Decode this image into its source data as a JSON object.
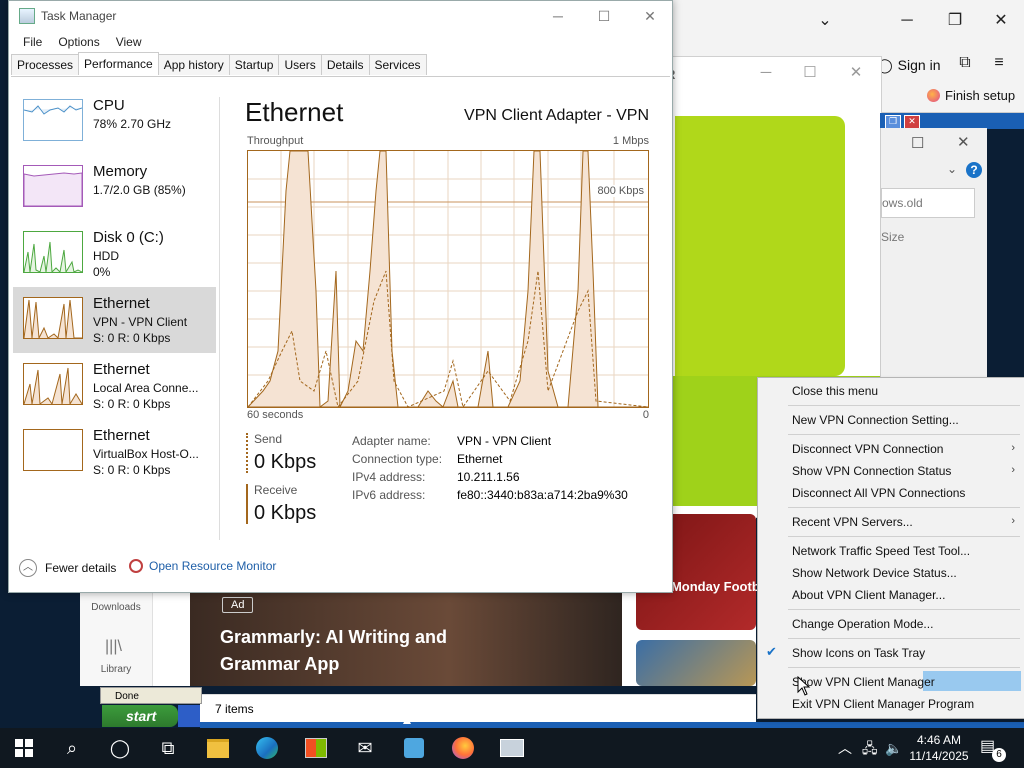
{
  "browser": {
    "sign_in": "Sign in",
    "finish_setup": "Finish setup",
    "downloads": "Downloads",
    "library": "Library",
    "ad_badge": "Ad",
    "ad_title": "Grammarly: AI Writing and Grammar App",
    "sports_text": "N - Monday Football",
    "status_items": "7 items"
  },
  "explorer": {
    "search_value": "ows.old",
    "column_size": "Size"
  },
  "xp": {
    "done": "Done",
    "start": "start"
  },
  "task_manager": {
    "title": "Task Manager",
    "menu": [
      "File",
      "Options",
      "View"
    ],
    "tabs": [
      "Processes",
      "Performance",
      "App history",
      "Startup",
      "Users",
      "Details",
      "Services"
    ],
    "active_tab": "Performance",
    "resources": [
      {
        "name": "CPU",
        "line1": "78%  2.70 GHz",
        "line2": ""
      },
      {
        "name": "Memory",
        "line1": "1.7/2.0 GB (85%)",
        "line2": ""
      },
      {
        "name": "Disk 0 (C:)",
        "line1": "HDD",
        "line2": "0%"
      },
      {
        "name": "Ethernet",
        "line1": "VPN - VPN Client",
        "line2": "S: 0  R: 0 Kbps"
      },
      {
        "name": "Ethernet",
        "line1": "Local Area Conne...",
        "line2": "S: 0  R: 0 Kbps"
      },
      {
        "name": "Ethernet",
        "line1": "VirtualBox Host-O...",
        "line2": "S: 0  R: 0 Kbps"
      }
    ],
    "selected_resource": 3,
    "detail": {
      "title": "Ethernet",
      "subtitle": "VPN Client Adapter - VPN",
      "throughput_label": "Throughput",
      "max_label": "1 Mbps",
      "ref_line_label": "800 Kbps",
      "time_label": "60 seconds",
      "zero_label": "0",
      "send_label": "Send",
      "send_value": "0 Kbps",
      "receive_label": "Receive",
      "receive_value": "0 Kbps",
      "adapter_name_label": "Adapter name:",
      "adapter_name": "VPN - VPN Client",
      "connection_type_label": "Connection type:",
      "connection_type": "Ethernet",
      "ipv4_label": "IPv4 address:",
      "ipv4": "10.211.1.56",
      "ipv6_label": "IPv6 address:",
      "ipv6": "fe80::3440:b83a:a714:2ba9%30"
    },
    "footer": {
      "fewer_details": "Fewer details",
      "open_resource_monitor": "Open Resource Monitor"
    }
  },
  "context_menu": {
    "items": [
      {
        "label": "Close this menu",
        "submenu": false,
        "checked": false
      },
      {
        "label": "New VPN Connection Setting...",
        "submenu": false,
        "checked": false
      },
      {
        "label": "Disconnect VPN Connection",
        "submenu": true,
        "checked": false
      },
      {
        "label": "Show VPN Connection Status",
        "submenu": true,
        "checked": false
      },
      {
        "label": "Disconnect All VPN Connections",
        "submenu": false,
        "checked": false
      },
      {
        "label": "Recent VPN Servers...",
        "submenu": true,
        "checked": false
      },
      {
        "label": "Network Traffic Speed Test Tool...",
        "submenu": false,
        "checked": false
      },
      {
        "label": "Show Network Device Status...",
        "submenu": false,
        "checked": false
      },
      {
        "label": "About VPN Client Manager...",
        "submenu": false,
        "checked": false
      },
      {
        "label": "Change Operation Mode...",
        "submenu": false,
        "checked": false
      },
      {
        "label": "Show Icons on Task Tray",
        "submenu": false,
        "checked": true
      },
      {
        "label": "Show VPN Client Manager",
        "submenu": false,
        "checked": false
      },
      {
        "label": "Exit VPN Client Manager Program",
        "submenu": false,
        "checked": false
      }
    ],
    "highlighted": "Show VPN Client Manager"
  },
  "taskbar": {
    "time": "4:46 AM",
    "date": "11/14/2025",
    "notification_count": "6"
  },
  "colors": {
    "ethernet_line": "#a3671d",
    "ethernet_fill": "#f5e3d3",
    "menu_highlight": "#99c9ef",
    "check": "#1a73c8",
    "green_panel": "#b0d81a"
  }
}
